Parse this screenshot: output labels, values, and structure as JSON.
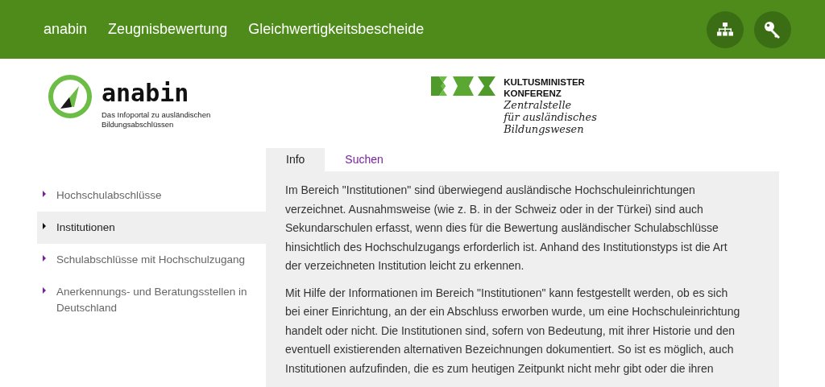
{
  "top_nav": {
    "links": [
      "anabin",
      "Zeugnisbewertung",
      "Gleichwertigkeitsbescheide"
    ]
  },
  "header": {
    "anabin_logo": {
      "name": "anabin",
      "tagline": [
        "Das Infoportal zu ausländischen",
        "Bildungsabschlüssen"
      ]
    },
    "kmk_logo": {
      "title": [
        "KULTUSMINISTER",
        "KONFERENZ"
      ],
      "subtitle": [
        "Zentralstelle",
        "für ausländisches",
        "Bildungswesen"
      ]
    }
  },
  "sidebar": {
    "items": [
      {
        "label": "Hochschulabschlüsse",
        "selected": false
      },
      {
        "label": "Institutionen",
        "selected": true
      },
      {
        "label": "Schulabschlüsse mit Hochschulzugang",
        "selected": false
      },
      {
        "label": "Anerkennungs- und Beratungsstellen in Deutschland",
        "selected": false
      }
    ]
  },
  "tabs": [
    {
      "label": "Info",
      "selected": true
    },
    {
      "label": "Suchen",
      "selected": false
    }
  ],
  "content": {
    "paragraphs": [
      "Im Bereich \"Institutionen\" sind überwiegend ausländische Hochschuleinrichtungen verzeichnet. Ausnahmsweise (wie z. B. in der Schweiz oder in der Türkei) sind auch Sekundarschulen erfasst, wenn dies für die Bewertung ausländischer Schulabschlüsse hinsichtlich des Hochschulzugangs erforderlich ist. Anhand des Institutionstyps ist die Art der verzeichneten Institution leicht zu erkennen.",
      "Mit Hilfe der Informationen im Bereich \"Institutionen\" kann festgestellt werden, ob es sich bei einer Einrichtung, an der ein Abschluss erworben wurde, um eine Hochschuleinrichtung handelt oder nicht. Die Institutionen sind, sofern von Bedeutung, mit ihrer Historie und den eventuell existierenden alternativen Bezeichnungen dokumentiert. So ist es möglich, auch Institutionen aufzufinden, die es zum heutigen Zeitpunkt nicht mehr gibt oder die ihren"
    ]
  }
}
